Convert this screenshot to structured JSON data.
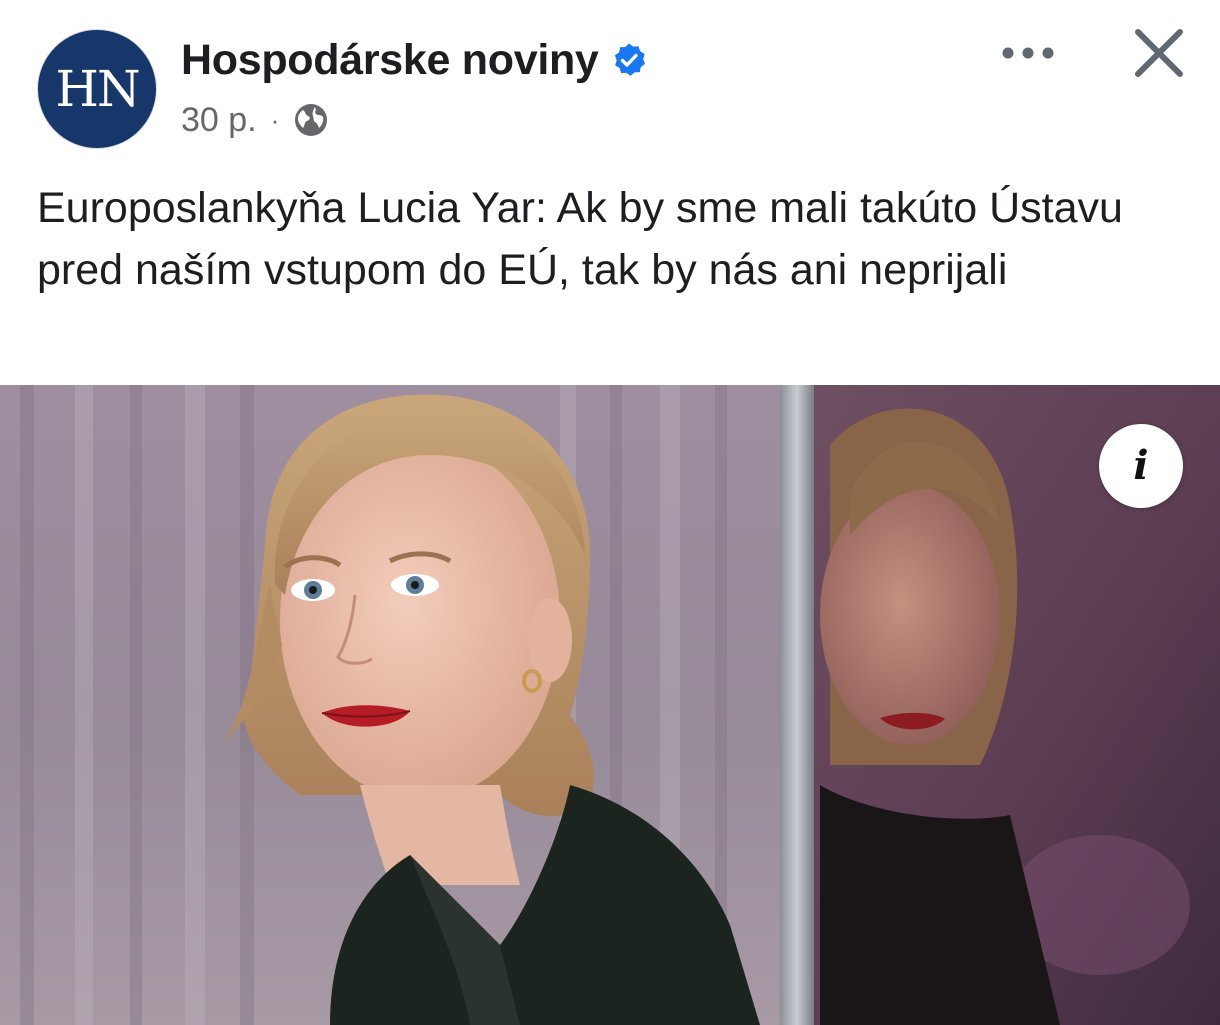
{
  "header": {
    "page_name": "Hospodárske noviny",
    "avatar_text": "HN",
    "timestamp": "30 p.",
    "separator": "·",
    "audience_icon": "globe-icon",
    "verified_icon": "verified-badge-icon"
  },
  "post": {
    "text": "Europoslankyňa Lucia Yar: Ak by sme mali takúto Ústavu pred naším vstupom do EÚ, tak by nás ani neprijali"
  },
  "photo": {
    "info_label": "i"
  },
  "colors": {
    "brand_avatar": "#17376a",
    "verified_blue": "#1877f2",
    "meta_gray": "#65676b"
  }
}
